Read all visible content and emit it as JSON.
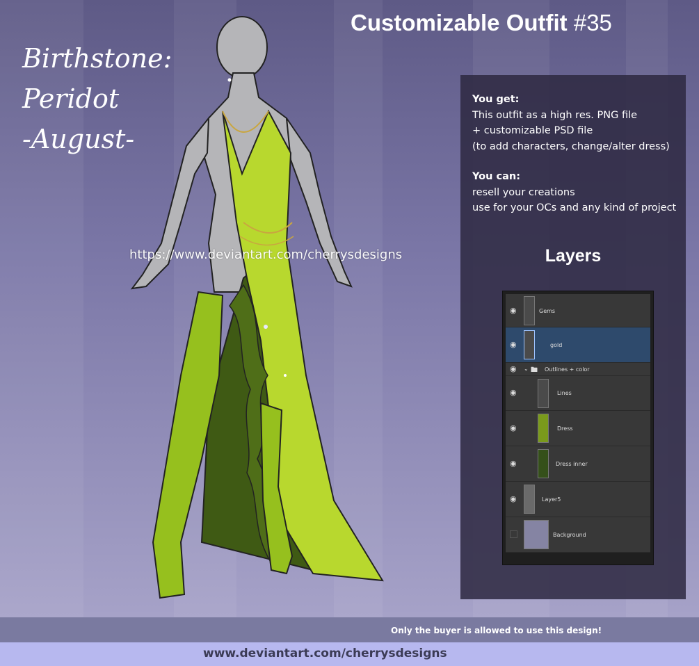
{
  "birthstone": {
    "line1": "Birthstone:",
    "line2": "Peridot",
    "line3": "-August-"
  },
  "title": {
    "main": "Customizable Outfit",
    "number": "#35"
  },
  "watermark": "https://www.deviantart.com/cherrysdesigns",
  "info": {
    "you_get": {
      "heading": "You get:",
      "lines": [
        "This outfit as a high res. PNG file",
        "+ customizable PSD file",
        "(to add characters, change/alter dress)"
      ]
    },
    "you_can": {
      "heading": "You can:",
      "lines": [
        "resell your creations",
        "use for your OCs and any kind of project"
      ]
    }
  },
  "layers": {
    "title": "Layers",
    "items": [
      {
        "name": "Gems"
      },
      {
        "name": "gold"
      },
      {
        "name": "Outlines + color"
      },
      {
        "name": "Lines"
      },
      {
        "name": "Dress"
      },
      {
        "name": "Dress inner"
      },
      {
        "name": "Layer5"
      },
      {
        "name": "Background"
      }
    ]
  },
  "footer": {
    "note": "Only the buyer is allowed to use this design!",
    "url": "www.deviantart.com/cherrysdesigns"
  },
  "colors": {
    "dress": "#b8d82e",
    "panel": "#2d2941",
    "selected_layer": "#2e4a6c",
    "footer_bar": "#b7b8ef"
  }
}
